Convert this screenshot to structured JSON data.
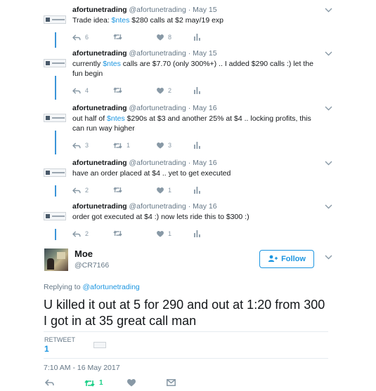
{
  "thread": [
    {
      "name": "afortunetrading",
      "handle": "@afortunetrading",
      "date": "May 15",
      "lines": [
        [
          {
            "t": "Trade idea: "
          },
          {
            "t": "$ntes",
            "hl": true
          },
          {
            "t": " $280 calls at $2 may/19 exp"
          }
        ]
      ],
      "replies": "6",
      "retweets": "",
      "likes": "8"
    },
    {
      "name": "afortunetrading",
      "handle": "@afortunetrading",
      "date": "May 15",
      "lines": [
        [
          {
            "t": "currently "
          },
          {
            "t": "$ntes",
            "hl": true
          },
          {
            "t": " calls are $7.70 (only 300%+) .. I added $290 calls :) let the"
          }
        ],
        [
          {
            "t": "fun begin"
          }
        ]
      ],
      "replies": "4",
      "retweets": "",
      "likes": "2"
    },
    {
      "name": "afortunetrading",
      "handle": "@afortunetrading",
      "date": "May 16",
      "lines": [
        [
          {
            "t": "out half of "
          },
          {
            "t": "$ntes",
            "hl": true
          },
          {
            "t": " $290s at $3 and another 25% at $4 .. locking profits, this"
          }
        ],
        [
          {
            "t": "can run way higher"
          }
        ]
      ],
      "replies": "3",
      "retweets": "1",
      "likes": "3"
    },
    {
      "name": "afortunetrading",
      "handle": "@afortunetrading",
      "date": "May 16",
      "lines": [
        [
          {
            "t": "have an order placed at $4 .. yet to get executed"
          }
        ]
      ],
      "replies": "2",
      "retweets": "",
      "likes": "1"
    },
    {
      "name": "afortunetrading",
      "handle": "@afortunetrading",
      "date": "May 16",
      "lines": [
        [
          {
            "t": "order got executed at $4 :) now lets ride this to $300 :)"
          }
        ]
      ],
      "replies": "2",
      "retweets": "",
      "likes": "1"
    }
  ],
  "separator": " · ",
  "focus": {
    "name": "Moe",
    "handle": "@CR7166",
    "follow_label": "Follow",
    "replying_prefix": "Replying to ",
    "replying_handle": "@afortunetrading",
    "text": "U killed it out at 5 for 290 and out at 1:20 from 300 I got in at 35 great call man",
    "retweet_label": "RETWEET",
    "retweet_count": "1",
    "timestamp": "7:10 AM - 16 May 2017",
    "bottom_retweets": "1"
  },
  "colors": {
    "accent": "#1b95e0",
    "retweet_green": "#19cf86",
    "muted": "#8899a6",
    "thread_line": "#3a94d8"
  },
  "icons": [
    "reply-icon",
    "retweet-icon",
    "like-icon",
    "analytics-icon",
    "chevron-down-icon",
    "follow-person-icon",
    "message-icon"
  ]
}
